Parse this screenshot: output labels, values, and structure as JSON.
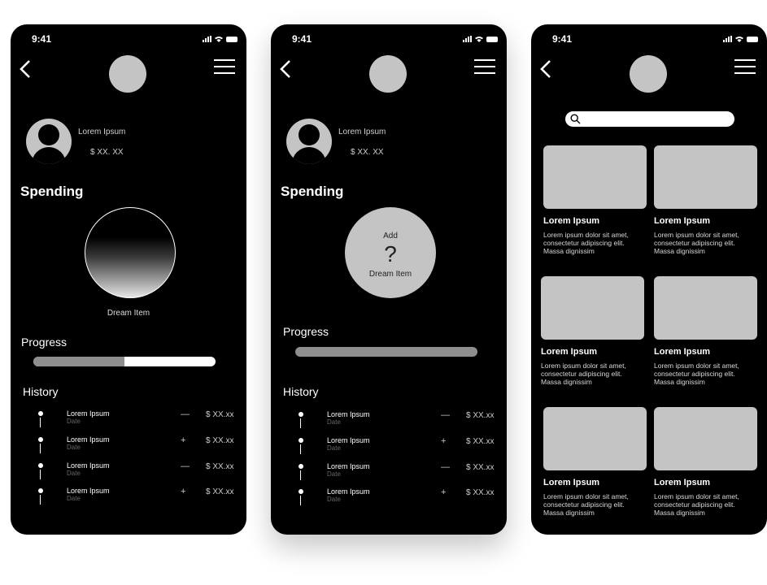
{
  "status_bar": {
    "time": "9:41"
  },
  "screens": [
    {
      "profile": {
        "name": "Lorem Ipsum",
        "amount": "$ XX. XX"
      },
      "spending_title": "Spending",
      "dream_item_label": "Dream Item",
      "progress_title": "Progress",
      "progress_fraction": 0.5,
      "history_title": "History",
      "history": [
        {
          "title": "Lorem Ipsum",
          "date": "Date",
          "sign": "—",
          "amount": "$ XX.xx"
        },
        {
          "title": "Lorem Ipsum",
          "date": "Date",
          "sign": "+",
          "amount": "$ XX.xx"
        },
        {
          "title": "Lorem Ipsum",
          "date": "Date",
          "sign": "—",
          "amount": "$ XX.xx"
        },
        {
          "title": "Lorem Ipsum",
          "date": "Date",
          "sign": "+",
          "amount": "$ XX.xx"
        }
      ]
    },
    {
      "profile": {
        "name": "Lorem Ipsum",
        "amount": "$ XX. XX"
      },
      "spending_title": "Spending",
      "add_item": {
        "add_label": "Add",
        "question": "?",
        "label": "Dream Item"
      },
      "progress_title": "Progress",
      "history_title": "History",
      "history": [
        {
          "title": "Lorem Ipsum",
          "date": "Date",
          "sign": "—",
          "amount": "$ XX.xx"
        },
        {
          "title": "Lorem Ipsum",
          "date": "Date",
          "sign": "+",
          "amount": "$ XX.xx"
        },
        {
          "title": "Lorem Ipsum",
          "date": "Date",
          "sign": "—",
          "amount": "$ XX.xx"
        },
        {
          "title": "Lorem Ipsum",
          "date": "Date",
          "sign": "+",
          "amount": "$ XX.xx"
        }
      ]
    },
    {
      "search": {
        "placeholder": ""
      },
      "cards": [
        {
          "title": "Lorem Ipsum",
          "description": "Lorem ipsum dolor sit amet, consectetur adipiscing elit. Massa dignissim"
        },
        {
          "title": "Lorem Ipsum",
          "description": "Lorem ipsum dolor sit amet, consectetur adipiscing elit. Massa dignissim"
        },
        {
          "title": "Lorem Ipsum",
          "description": "Lorem ipsum dolor sit amet, consectetur adipiscing elit. Massa dignissim"
        },
        {
          "title": "Lorem Ipsum",
          "description": "Lorem ipsum dolor sit amet, consectetur adipiscing elit. Massa dignissim"
        },
        {
          "title": "Lorem Ipsum",
          "description": "Lorem ipsum dolor sit amet, consectetur adipiscing elit. Massa dignissim"
        },
        {
          "title": "Lorem Ipsum",
          "description": "Lorem ipsum dolor sit amet, consectetur adipiscing elit. Massa dignissim"
        }
      ]
    }
  ],
  "icons": [
    "back-arrow-icon",
    "menu-icon",
    "signal-icon",
    "wifi-icon",
    "battery-icon",
    "user-avatar-icon",
    "search-icon"
  ],
  "colors": {
    "phone_bg": "#000000",
    "placeholder_grey": "#c4c4c4",
    "progress_grey": "#8e8e8e"
  }
}
